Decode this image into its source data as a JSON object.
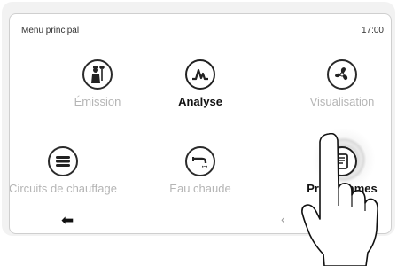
{
  "header": {
    "title": "Menu principal",
    "time": "17:00"
  },
  "tiles": [
    {
      "label": "Émission",
      "icon": "chimney-sweep-icon"
    },
    {
      "label": "Analyse",
      "icon": "analysis-peak-icon"
    },
    {
      "label": "Visualisation",
      "icon": "fan-icon"
    },
    {
      "label": "Circuits de chauffage",
      "icon": "radiator-icon"
    },
    {
      "label": "Eau chaude",
      "icon": "faucet-icon"
    },
    {
      "label": "Programmes",
      "icon": "program-list-icon"
    }
  ],
  "footer": {
    "back_glyph": "⬅",
    "prev_glyph": "‹"
  }
}
